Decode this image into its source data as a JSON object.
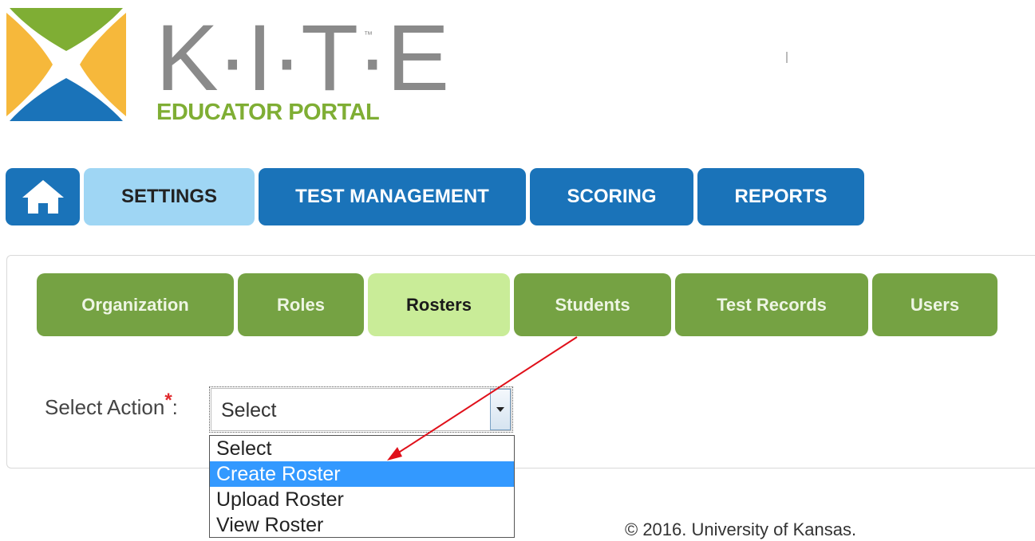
{
  "logo": {
    "wordmark": "K·I·T·E",
    "trademark": "™",
    "subtitle": "EDUCATOR PORTAL",
    "colors": {
      "green": "#7fae34",
      "gold": "#f6b83b",
      "blue": "#1a73b9",
      "gray": "#8a8a8a"
    }
  },
  "main_nav": {
    "home_icon": "home-icon",
    "items": [
      {
        "label": "SETTINGS",
        "active": true
      },
      {
        "label": "TEST MANAGEMENT",
        "active": false
      },
      {
        "label": "SCORING",
        "active": false
      },
      {
        "label": "REPORTS",
        "active": false
      }
    ],
    "colors": {
      "default": "#1a73b9",
      "active": "#9fd6f4"
    }
  },
  "sub_nav": {
    "items": [
      {
        "label": "Organization",
        "active": false
      },
      {
        "label": "Roles",
        "active": false
      },
      {
        "label": "Rosters",
        "active": true
      },
      {
        "label": "Students",
        "active": false
      },
      {
        "label": "Test Records",
        "active": false
      },
      {
        "label": "Users",
        "active": false
      }
    ],
    "colors": {
      "default": "#75a243",
      "active": "#c9ec98"
    }
  },
  "select_action": {
    "label": "Select Action",
    "required_mark": "*",
    "colon": ":",
    "selected_value": "Select",
    "options": [
      {
        "label": "Select",
        "highlighted": false
      },
      {
        "label": "Create Roster",
        "highlighted": true
      },
      {
        "label": "Upload Roster",
        "highlighted": false
      },
      {
        "label": "View Roster",
        "highlighted": false
      }
    ],
    "highlight_color": "#3399ff"
  },
  "annotation": {
    "arrow_color": "#e0101a"
  },
  "footer": {
    "copyright": "© 2016. University of Kansas."
  }
}
